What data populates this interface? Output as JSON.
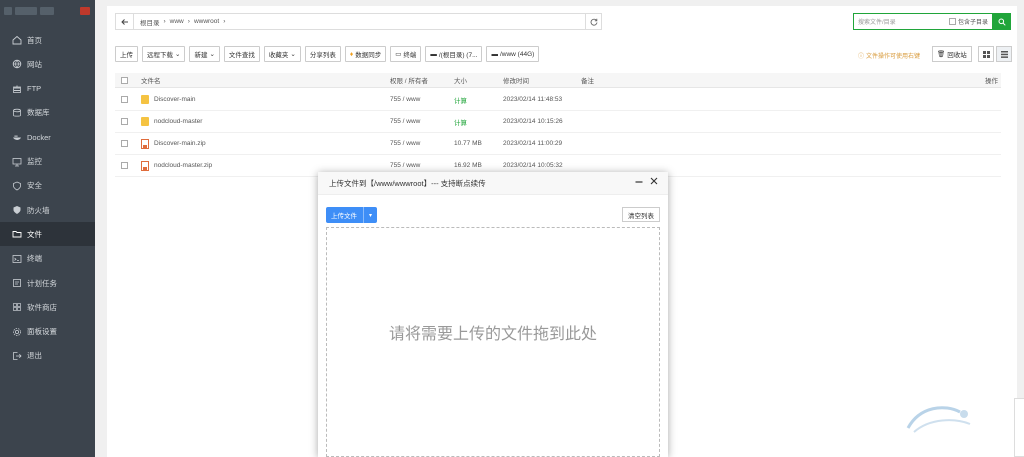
{
  "sidebar": {
    "items": [
      {
        "label": "首页",
        "icon": "home-icon"
      },
      {
        "label": "网站",
        "icon": "globe-icon"
      },
      {
        "label": "FTP",
        "icon": "ftp-icon"
      },
      {
        "label": "数据库",
        "icon": "database-icon"
      },
      {
        "label": "Docker",
        "icon": "docker-icon"
      },
      {
        "label": "监控",
        "icon": "monitor-icon"
      },
      {
        "label": "安全",
        "icon": "shield-icon"
      },
      {
        "label": "防火墙",
        "icon": "firewall-icon"
      },
      {
        "label": "文件",
        "icon": "folder-icon",
        "active": true
      },
      {
        "label": "终端",
        "icon": "terminal-icon"
      },
      {
        "label": "计划任务",
        "icon": "clock-icon"
      },
      {
        "label": "软件商店",
        "icon": "grid-icon"
      },
      {
        "label": "面板设置",
        "icon": "gear-icon"
      },
      {
        "label": "退出",
        "icon": "logout-icon"
      }
    ]
  },
  "pathbar": {
    "crumbs": [
      "根目录",
      "www",
      "wwwroot"
    ],
    "search_placeholder": "搜索文件/目录",
    "include_sub_label": "包含子目录"
  },
  "toolbar": {
    "upload": "上传",
    "remote_download": "远程下载",
    "new": "新建",
    "file_search": "文件查找",
    "favorites": "收藏夹",
    "share_list": "分享列表",
    "data_sync": "数据同步",
    "terminal": "终端",
    "disk_root": "/(根目录) (7...",
    "disk_www": "/www (44G)",
    "tips": "文件操作可使用右键",
    "recycle": "回收站"
  },
  "table": {
    "headers": {
      "name": "文件名",
      "perm": "权限 / 所有者",
      "size": "大小",
      "mtime": "修改时间",
      "note": "备注",
      "ops": "操作"
    },
    "rows": [
      {
        "name": "Discover-main",
        "type": "folder",
        "perm": "755 / www",
        "size": "计算",
        "mtime": "2023/02/14 11:48:53"
      },
      {
        "name": "nodcloud-master",
        "type": "folder",
        "perm": "755 / www",
        "size": "计算",
        "mtime": "2023/02/14 10:15:26"
      },
      {
        "name": "Discover-main.zip",
        "type": "zip",
        "perm": "755 / www",
        "size": "10.77 MB",
        "mtime": "2023/02/14 11:00:29"
      },
      {
        "name": "nodcloud-master.zip",
        "type": "zip",
        "perm": "755 / www",
        "size": "16.92 MB",
        "mtime": "2023/02/14 10:05:32"
      }
    ]
  },
  "modal": {
    "title": "上传文件到【/www/wwwroot】--- 支持断点续传",
    "upload_button": "上传文件",
    "clear_button": "清空列表",
    "dropzone_text": "请将需要上传的文件拖到此处"
  },
  "colors": {
    "sidebar_bg": "#3c444d",
    "accent_green": "#20a53a",
    "upload_blue": "#3e8ef7"
  }
}
